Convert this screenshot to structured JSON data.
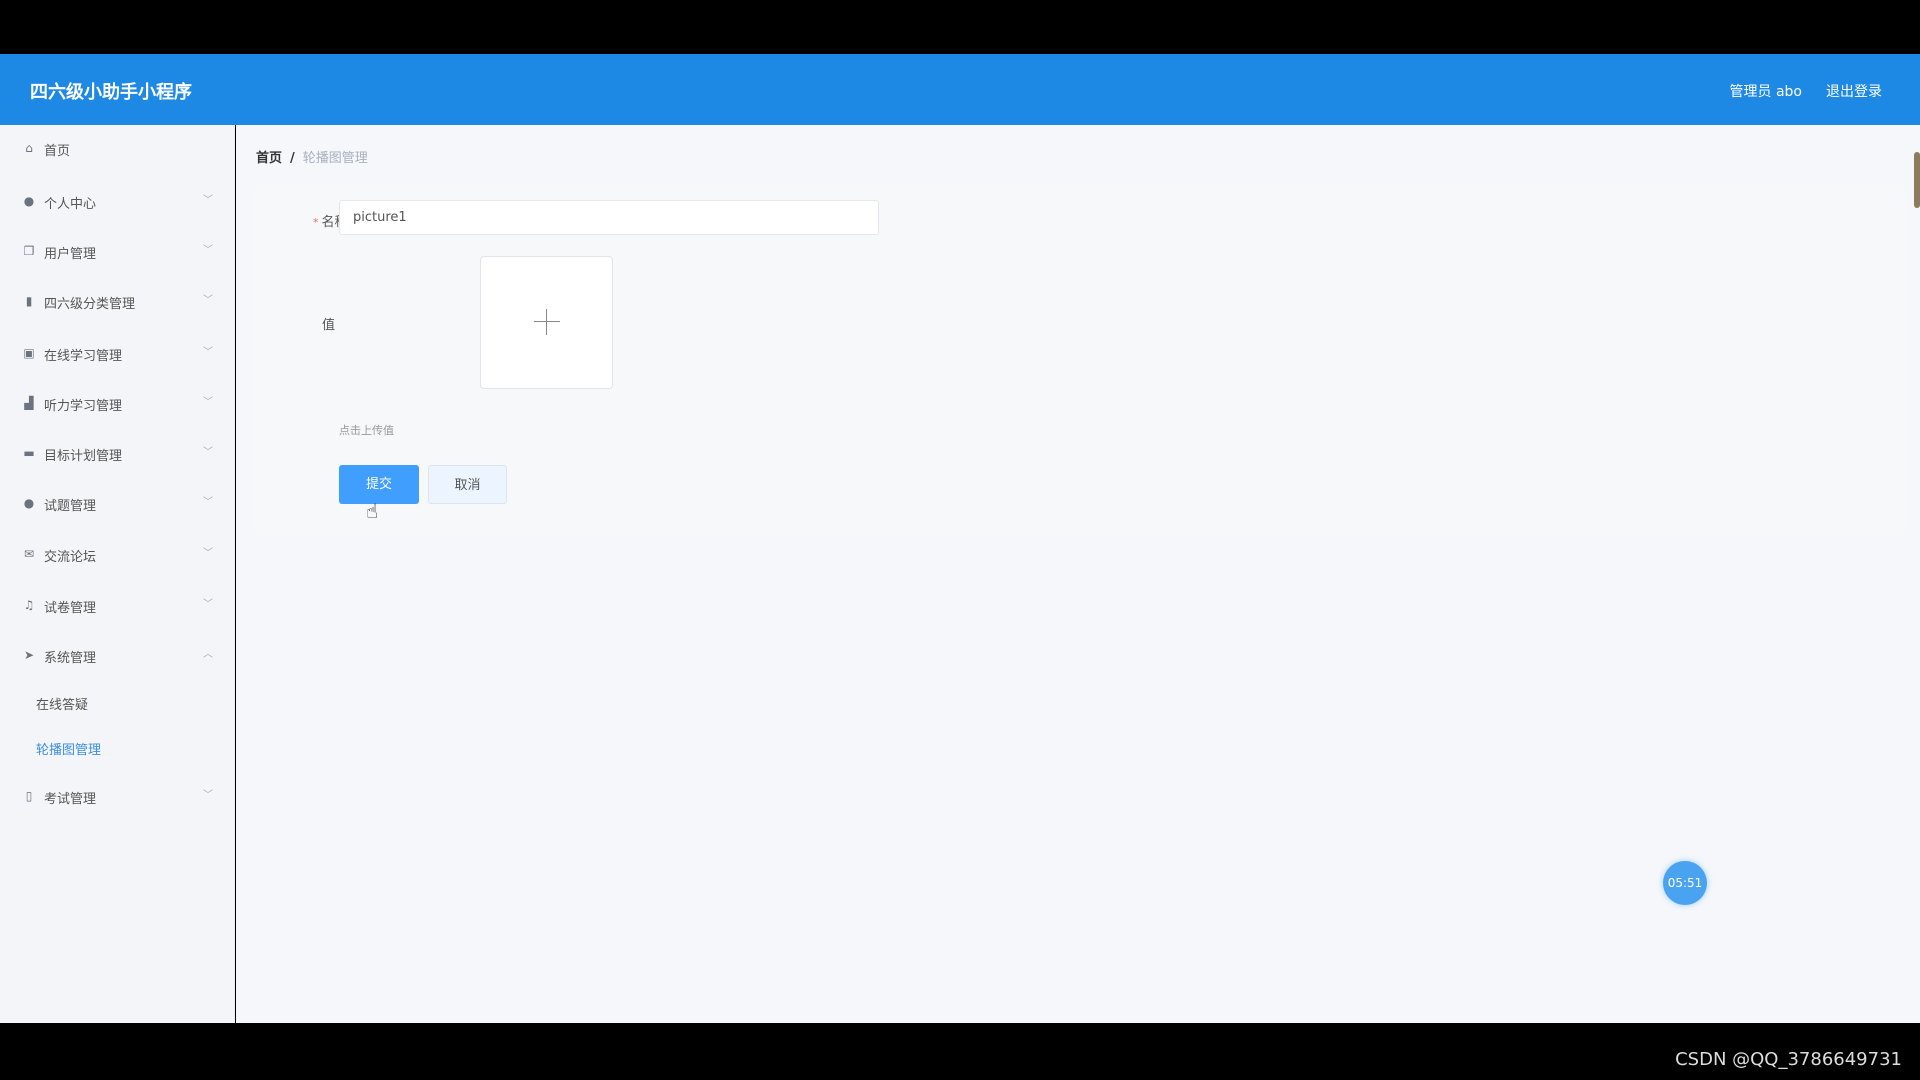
{
  "header": {
    "title": "四六级小助手小程序",
    "user": "管理员 abo",
    "logout": "退出登录",
    "color": "#1e88e5"
  },
  "sidebar": {
    "items": [
      {
        "label": "首页",
        "icon": "home-icon"
      },
      {
        "label": "个人中心",
        "icon": "user-icon"
      },
      {
        "label": "用户管理",
        "icon": "copy-icon"
      },
      {
        "label": "四六级分类管理",
        "icon": "bars-icon"
      },
      {
        "label": "在线学习管理",
        "icon": "clipboard-icon"
      },
      {
        "label": "听力学习管理",
        "icon": "chart-icon"
      },
      {
        "label": "目标计划管理",
        "icon": "ticket-icon"
      },
      {
        "label": "试题管理",
        "icon": "pin-icon"
      },
      {
        "label": "交流论坛",
        "icon": "mail-icon"
      },
      {
        "label": "试卷管理",
        "icon": "bell-icon"
      },
      {
        "label": "系统管理",
        "icon": "send-icon"
      },
      {
        "label": "考试管理",
        "icon": "mic-icon"
      }
    ],
    "system_sub": [
      {
        "label": "在线答疑"
      },
      {
        "label": "轮播图管理",
        "active": true
      }
    ]
  },
  "breadcrumb": {
    "home": "首页",
    "sep": "/",
    "current": "轮播图管理"
  },
  "form": {
    "name_label": "名称",
    "required_mark": "*",
    "name_value": "picture1",
    "value_label": "值",
    "upload_hint": "点击上传值",
    "submit": "提交",
    "cancel": "取消"
  },
  "timer": "05:51",
  "watermark": "CSDN @QQ_3786649731"
}
